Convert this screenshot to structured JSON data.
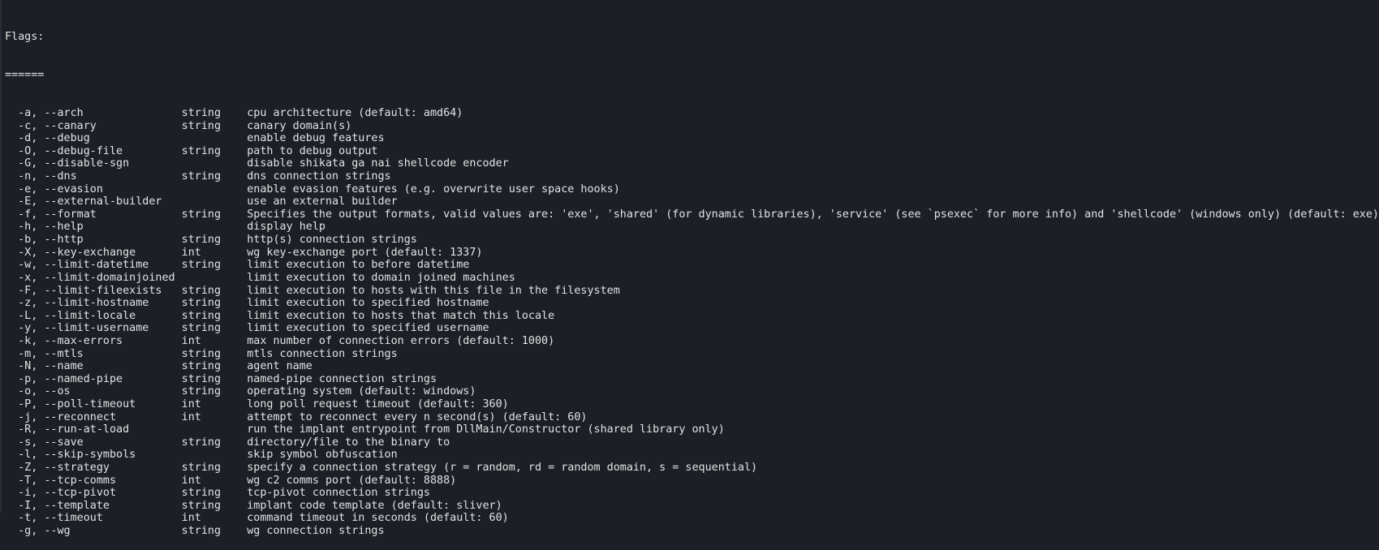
{
  "header": {
    "title": "Flags:",
    "underline": "======"
  },
  "flags": [
    {
      "flag": "-a, --arch",
      "type": "string",
      "desc": "cpu architecture (default: amd64)"
    },
    {
      "flag": "-c, --canary",
      "type": "string",
      "desc": "canary domain(s)"
    },
    {
      "flag": "-d, --debug",
      "type": "",
      "desc": "enable debug features"
    },
    {
      "flag": "-O, --debug-file",
      "type": "string",
      "desc": "path to debug output"
    },
    {
      "flag": "-G, --disable-sgn",
      "type": "",
      "desc": "disable shikata ga nai shellcode encoder"
    },
    {
      "flag": "-n, --dns",
      "type": "string",
      "desc": "dns connection strings"
    },
    {
      "flag": "-e, --evasion",
      "type": "",
      "desc": "enable evasion features (e.g. overwrite user space hooks)"
    },
    {
      "flag": "-E, --external-builder",
      "type": "",
      "desc": "use an external builder"
    },
    {
      "flag": "-f, --format",
      "type": "string",
      "desc": "Specifies the output formats, valid values are: 'exe', 'shared' (for dynamic libraries), 'service' (see `psexec` for more info) and 'shellcode' (windows only) (default: exe)"
    },
    {
      "flag": "-h, --help",
      "type": "",
      "desc": "display help"
    },
    {
      "flag": "-b, --http",
      "type": "string",
      "desc": "http(s) connection strings"
    },
    {
      "flag": "-X, --key-exchange",
      "type": "int",
      "desc": "wg key-exchange port (default: 1337)"
    },
    {
      "flag": "-w, --limit-datetime",
      "type": "string",
      "desc": "limit execution to before datetime"
    },
    {
      "flag": "-x, --limit-domainjoined",
      "type": "",
      "desc": "limit execution to domain joined machines"
    },
    {
      "flag": "-F, --limit-fileexists",
      "type": "string",
      "desc": "limit execution to hosts with this file in the filesystem"
    },
    {
      "flag": "-z, --limit-hostname",
      "type": "string",
      "desc": "limit execution to specified hostname"
    },
    {
      "flag": "-L, --limit-locale",
      "type": "string",
      "desc": "limit execution to hosts that match this locale"
    },
    {
      "flag": "-y, --limit-username",
      "type": "string",
      "desc": "limit execution to specified username"
    },
    {
      "flag": "-k, --max-errors",
      "type": "int",
      "desc": "max number of connection errors (default: 1000)"
    },
    {
      "flag": "-m, --mtls",
      "type": "string",
      "desc": "mtls connection strings"
    },
    {
      "flag": "-N, --name",
      "type": "string",
      "desc": "agent name"
    },
    {
      "flag": "-p, --named-pipe",
      "type": "string",
      "desc": "named-pipe connection strings"
    },
    {
      "flag": "-o, --os",
      "type": "string",
      "desc": "operating system (default: windows)"
    },
    {
      "flag": "-P, --poll-timeout",
      "type": "int",
      "desc": "long poll request timeout (default: 360)"
    },
    {
      "flag": "-j, --reconnect",
      "type": "int",
      "desc": "attempt to reconnect every n second(s) (default: 60)"
    },
    {
      "flag": "-R, --run-at-load",
      "type": "",
      "desc": "run the implant entrypoint from DllMain/Constructor (shared library only)"
    },
    {
      "flag": "-s, --save",
      "type": "string",
      "desc": "directory/file to the binary to"
    },
    {
      "flag": "-l, --skip-symbols",
      "type": "",
      "desc": "skip symbol obfuscation"
    },
    {
      "flag": "-Z, --strategy",
      "type": "string",
      "desc": "specify a connection strategy (r = random, rd = random domain, s = sequential)"
    },
    {
      "flag": "-T, --tcp-comms",
      "type": "int",
      "desc": "wg c2 comms port (default: 8888)"
    },
    {
      "flag": "-i, --tcp-pivot",
      "type": "string",
      "desc": "tcp-pivot connection strings"
    },
    {
      "flag": "-I, --template",
      "type": "string",
      "desc": "implant code template (default: sliver)"
    },
    {
      "flag": "-t, --timeout",
      "type": "int",
      "desc": "command timeout in seconds (default: 60)"
    },
    {
      "flag": "-g, --wg",
      "type": "string",
      "desc": "wg connection strings"
    }
  ],
  "colors": {
    "background": "#1c1f26",
    "foreground": "#e3e3e3"
  }
}
